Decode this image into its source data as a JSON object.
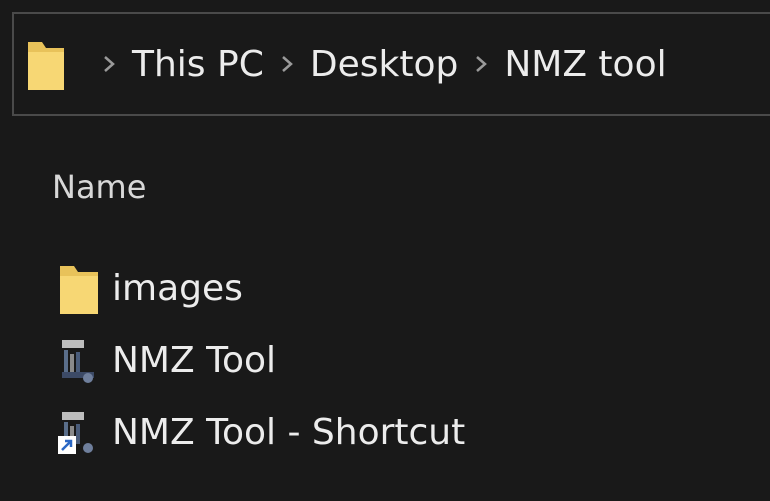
{
  "breadcrumb": {
    "folder_icon": "folder-icon",
    "separator_icon": "chevron-right-icon",
    "items": [
      "This PC",
      "Desktop",
      "NMZ tool"
    ]
  },
  "columns": {
    "name": "Name"
  },
  "files": [
    {
      "name": "images",
      "icon": "folder-icon"
    },
    {
      "name": "NMZ Tool",
      "icon": "application-icon"
    },
    {
      "name": "NMZ Tool - Shortcut",
      "icon": "shortcut-icon"
    }
  ],
  "colors": {
    "background": "#191919",
    "border": "#4a4a4a",
    "folder": "#f5d36b",
    "text": "#ececec"
  }
}
